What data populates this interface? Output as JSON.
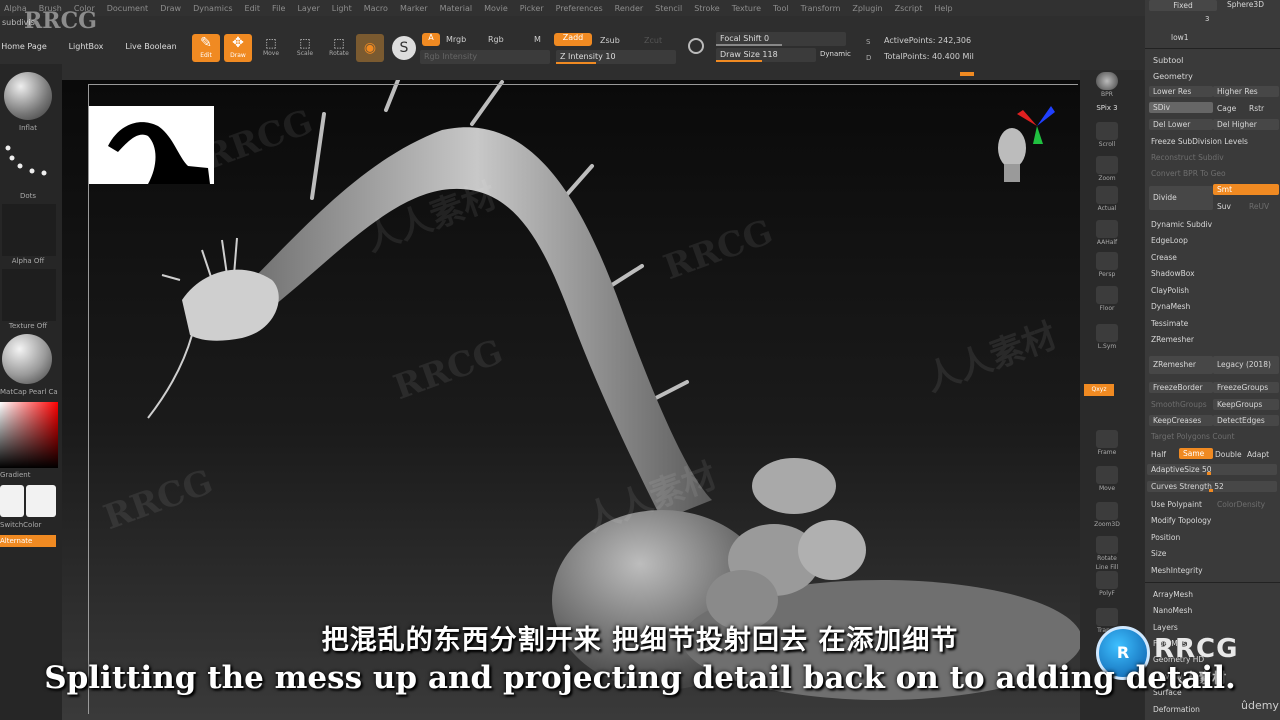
{
  "watermark_top": "RRCG",
  "watermarks": [
    "RRCG",
    "人人素材"
  ],
  "menu": [
    "Alpha",
    "Brush",
    "Color",
    "Document",
    "Draw",
    "Dynamics",
    "Edit",
    "File",
    "Layer",
    "Light",
    "Macro",
    "Marker",
    "Material",
    "Movie",
    "Picker",
    "Preferences",
    "Render",
    "Stencil",
    "Stroke",
    "Texture",
    "Tool",
    "Transform",
    "Zplugin",
    "Zscript",
    "Help"
  ],
  "toolbar": {
    "subdiv_label": "subdivis",
    "home_page": "Home Page",
    "lightbox": "LightBox",
    "live_boolean": "Live Boolean",
    "edit": "Edit",
    "draw": "Draw",
    "move": "Move",
    "scale": "Scale",
    "rotate": "Rotate",
    "a_label": "A",
    "mrgb": "Mrgb",
    "rgb": "Rgb",
    "m": "M",
    "zadd": "Zadd",
    "zsub": "Zsub",
    "zcut": "Zcut",
    "rgb_intensity": "Rgb Intensity",
    "z_intensity": "Z Intensity 10",
    "focal_shift": "Focal Shift 0",
    "draw_size": "Draw Size 118",
    "dynamic": "Dynamic",
    "s_label": "S",
    "d_label": "D",
    "active_points": "ActivePoints: 242,306",
    "total_points": "TotalPoints: 40.400 Mil"
  },
  "left": {
    "inflat": "Inflat",
    "dots": "Dots",
    "alpha_off": "Alpha Off",
    "texture_off": "Texture Off",
    "matcap": "MatCap Pearl Ca",
    "gradient": "Gradient",
    "switch_color": "SwitchColor",
    "alternate": "Alternate"
  },
  "dock": {
    "bpr": "BPR",
    "spix": "SPix 3",
    "scroll": "Scroll",
    "zoom": "Zoom",
    "actual": "Actual",
    "aahalf": "AAHalf",
    "persp": "Persp",
    "floor": "Floor",
    "lsym": "L.Sym",
    "qxyz": "Qxyz",
    "frame": "Frame",
    "move": "Move",
    "zoom3d": "Zoom3D",
    "rotate": "Rotate",
    "linefill": "Line Fill",
    "polyf": "PolyF",
    "transp": "Transp"
  },
  "panel": {
    "fixed": "Fixed",
    "sphere3d": "Sphere3D",
    "count": "3",
    "low1": "low1",
    "subtool": "Subtool",
    "geometry": "Geometry",
    "lower_res": "Lower Res",
    "higher_res": "Higher Res",
    "sdiv": "SDiv",
    "cage": "Cage",
    "rstr": "Rstr",
    "del_lower": "Del Lower",
    "del_higher": "Del Higher",
    "freeze_subdiv": "Freeze SubDivision Levels",
    "reconstruct": "Reconstruct Subdiv",
    "convert_bpr": "Convert BPR To Geo",
    "divide": "Divide",
    "smt": "Smt",
    "suv": "Suv",
    "reuv": "ReUV",
    "dynamic_subdiv": "Dynamic Subdiv",
    "edgeloop": "EdgeLoop",
    "crease": "Crease",
    "shadowbox": "ShadowBox",
    "claypolish": "ClayPolish",
    "dynamesh": "DynaMesh",
    "tessimate": "Tessimate",
    "zremesher_header": "ZRemesher",
    "zremesher": "ZRemesher",
    "legacy": "Legacy (2018)",
    "freeze_border": "FreezeBorder",
    "freeze_groups": "FreezeGroups",
    "smooth_groups": "SmoothGroups",
    "keep_groups": "KeepGroups",
    "keep_creases": "KeepCreases",
    "detect_edges": "DetectEdges",
    "target_polygons": "Target Polygons Count",
    "half": "Half",
    "same": "Same",
    "double": "Double",
    "adapt": "Adapt",
    "adaptive_size": "AdaptiveSize 50",
    "curves_strength": "Curves Strength 52",
    "use_polypaint": "Use Polypaint",
    "color_density": "ColorDensity",
    "modify_topology": "Modify Topology",
    "position": "Position",
    "size": "Size",
    "mesh_integrity": "MeshIntegrity",
    "array_mesh": "ArrayMesh",
    "nano_mesh": "NanoMesh",
    "layers": "Layers",
    "fibermesh": "FiberMesh",
    "geometry_hd": "Geometry HD",
    "preview": "Preview",
    "surface": "Surface",
    "deformation": "Deformation",
    "udemy": "ûdemy"
  },
  "logo": {
    "text": "RRCG",
    "sub": "人人素材"
  },
  "subtitles": {
    "cn": "把混乱的东西分割开来 把细节投射回去 在添加细节",
    "en": "Splitting the mess up and projecting detail back on to adding detail."
  },
  "colors": {
    "accent": "#f08a22"
  }
}
